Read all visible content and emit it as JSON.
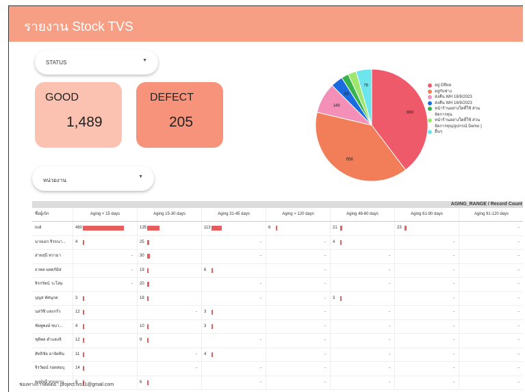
{
  "header": {
    "title": "รายงาน Stock TVS",
    "color": "#f79f84"
  },
  "filters": {
    "status": {
      "label": "STATUS"
    },
    "second": {
      "label": "หน่วยงาน"
    }
  },
  "cards": {
    "good": {
      "title": "GOOD",
      "value": "1,489",
      "color": "#fbc2b1"
    },
    "defect": {
      "title": "DEFECT",
      "value": "205",
      "color": "#f7937a"
    }
  },
  "chart_data": {
    "type": "pie",
    "slices": [
      {
        "label": "อยู่ Office",
        "value": 669,
        "color": "#ef5a6a"
      },
      {
        "label": "อยู่กับช่าง",
        "value": 658,
        "color": "#f17e58"
      },
      {
        "label": "ส่งคืน WH 18/9/2023",
        "value": 149,
        "color": "#f48fb8"
      },
      {
        "label": "ส่งคืน WH 16/9/2023",
        "value": 59,
        "color": "#1a6be0"
      },
      {
        "label": "หน้าร้านอย่างใด",
        "value": 35,
        "color": "#37b24d"
      },
      {
        "label": "เก็บสำรอง",
        "value": 40,
        "color": "#9ee66e"
      },
      {
        "label": "อื่นๆ",
        "value": 76,
        "color": "#6ce5ec"
      }
    ],
    "legend": [
      "อยู่ Office",
      "อยู่กับช่าง",
      "ส่งคืน WH 18/9/2023",
      "ส่งคืน WH 16/9/2023",
      "หน้าร้านอย่างใดที่ใช้ ส่วนจัดการทุน",
      "หน้าร้านอย่างใดที่ใช้ ส่วนจัดการทุน(อุปกรณ์ Demo )",
      "อื่นๆ"
    ],
    "data_labels": [
      "669",
      "658",
      "149",
      "59",
      "76"
    ]
  },
  "table": {
    "title": "AGING_RANGE / Record Count",
    "columns": [
      "ชื่อผู้เบิก",
      "Aging < 15 days",
      "Aging 15-30 days",
      "Aging 31-45 days",
      "Aging > 120 days",
      "Aging 46-60 days",
      "Aging 61-90 days",
      "Aging 91-120 days"
    ],
    "rows": [
      {
        "name": "null",
        "cells": [
          "460",
          "135",
          "113",
          "6",
          "21",
          "23",
          "-"
        ]
      },
      {
        "name": "นายเอก จิรธนา...",
        "cells": [
          "4",
          "25",
          "-",
          "-",
          "4",
          "-",
          "-"
        ]
      },
      {
        "name": "สายสุนี ทวามา",
        "cells": [
          "-",
          "30",
          "-",
          "-",
          "-",
          "-",
          "-"
        ]
      },
      {
        "name": "ธวพล ผลดกัมิส",
        "cells": [
          "-",
          "19",
          "6",
          "-",
          "-",
          "-",
          "-"
        ]
      },
      {
        "name": "จิรกรัตน์ วะโสม",
        "cells": [
          "-",
          "20",
          "-",
          "-",
          "-",
          "-",
          "-"
        ]
      },
      {
        "name": "บุญส ทัศนุกต",
        "cells": [
          "3",
          "18",
          "-",
          "-",
          "3",
          "-",
          "-"
        ]
      },
      {
        "name": "นสวัชิ แสงกร์ว",
        "cells": [
          "12",
          "-",
          "3",
          "-",
          "-",
          "-",
          "-"
        ]
      },
      {
        "name": "ชัยพูพงษ์ ชบา...",
        "cells": [
          "4",
          "10",
          "3",
          "-",
          "-",
          "-",
          "-"
        ]
      },
      {
        "name": "ชุติพล ดำแดงจิ",
        "cells": [
          "12",
          "9",
          "-",
          "-",
          "-",
          "-",
          "-"
        ]
      },
      {
        "name": "สัทธิชัย อาจัตทิน",
        "cells": [
          "11",
          "-",
          "4",
          "-",
          "-",
          "-",
          "-"
        ]
      },
      {
        "name": "จิรวัฒน์ รอดสมบุ",
        "cells": [
          "14",
          "-",
          "-",
          "-",
          "-",
          "-",
          "-"
        ]
      },
      {
        "name": "พงษ์ทวี ทวบมาน",
        "cells": [
          "8",
          "6",
          "-",
          "-",
          "-",
          "-",
          "-"
        ]
      }
    ],
    "bar_color": "#e75d5d",
    "max_value": 460
  },
  "footer": {
    "text": "ช่องทางการติดต่อ : project.tvs11@gmail.com"
  }
}
